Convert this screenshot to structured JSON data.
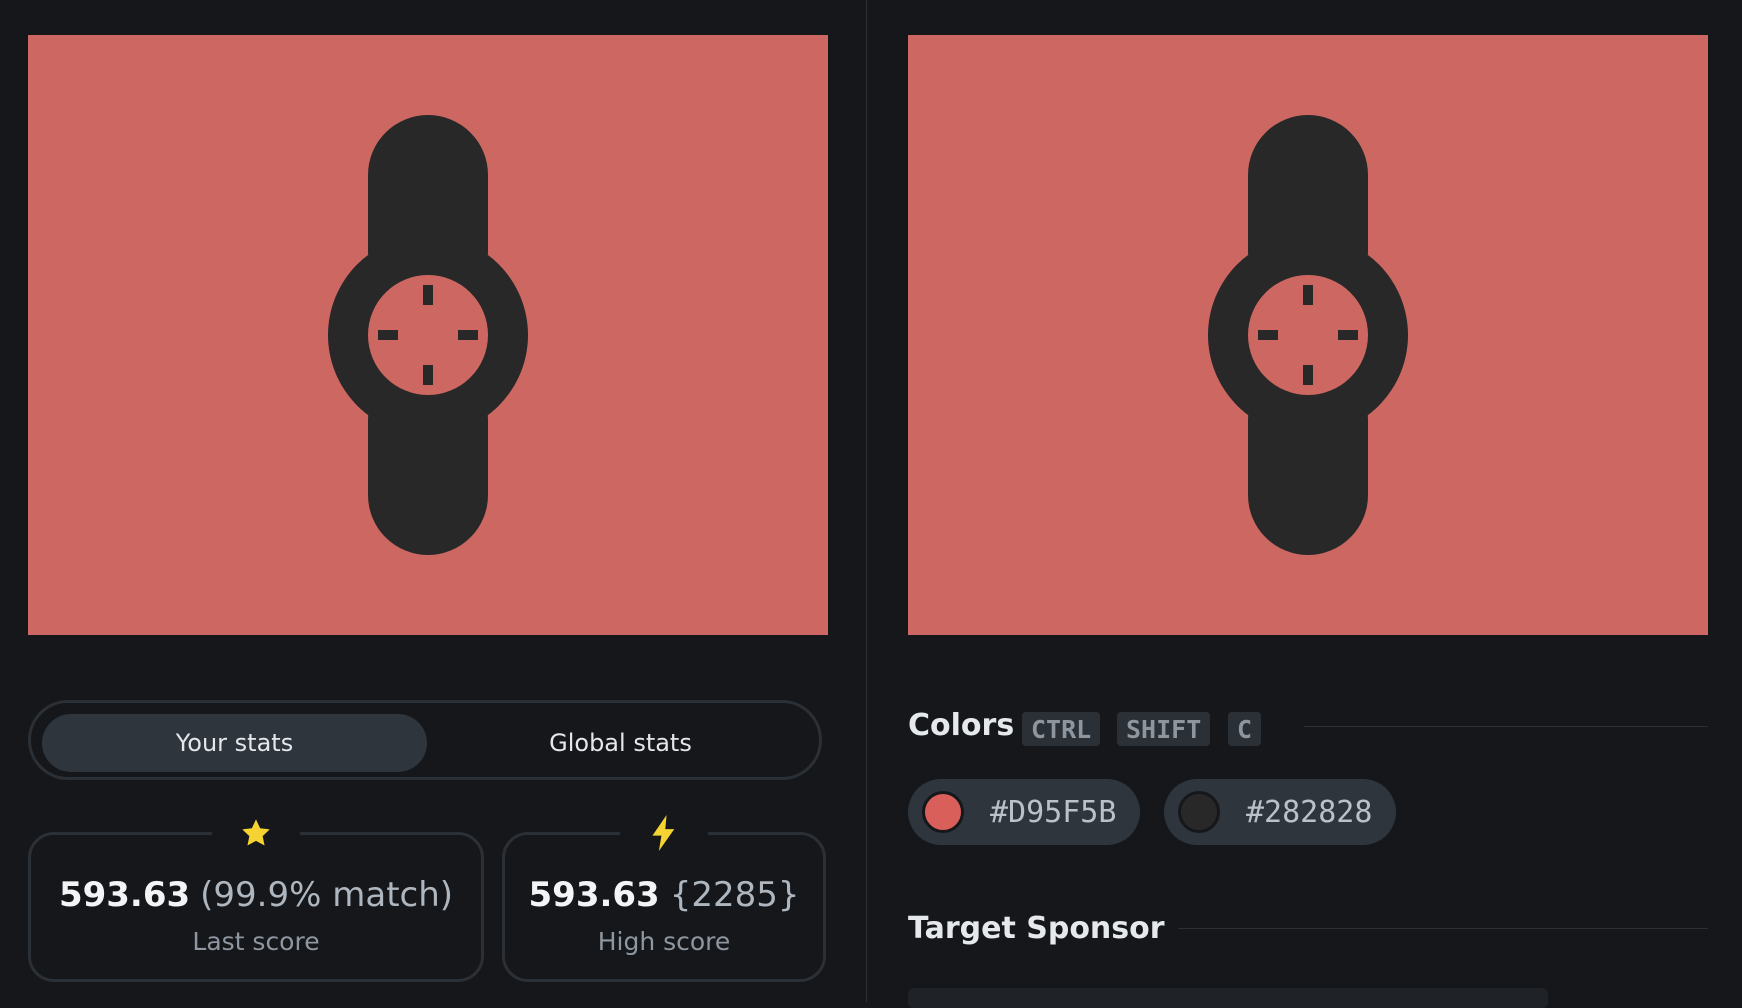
{
  "target": {
    "background_color": "#CC6761",
    "shape_color": "#282828",
    "icon": "watch-icon"
  },
  "preview": {
    "background_color": "#CC6761",
    "shape_color": "#282828",
    "icon": "watch-icon"
  },
  "stats_tabs": {
    "your_label": "Your stats",
    "global_label": "Global stats",
    "active": "your"
  },
  "last_score": {
    "icon": "star-icon",
    "value": "593.63",
    "extra": "(99.9% match)",
    "caption": "Last score"
  },
  "high_score": {
    "icon": "lightning-icon",
    "value": "593.63",
    "extra": "{2285}",
    "caption": "High score"
  },
  "colors": {
    "title": "Colors",
    "shortcut": [
      "CTRL",
      "SHIFT",
      "C"
    ],
    "swatches": [
      {
        "hex": "#D95F5B",
        "dot": "#D95F5B"
      },
      {
        "hex": "#282828",
        "dot": "#282828"
      }
    ]
  },
  "sponsor": {
    "title": "Target Sponsor"
  },
  "theme": {
    "accent_yellow": "#F5D332"
  }
}
